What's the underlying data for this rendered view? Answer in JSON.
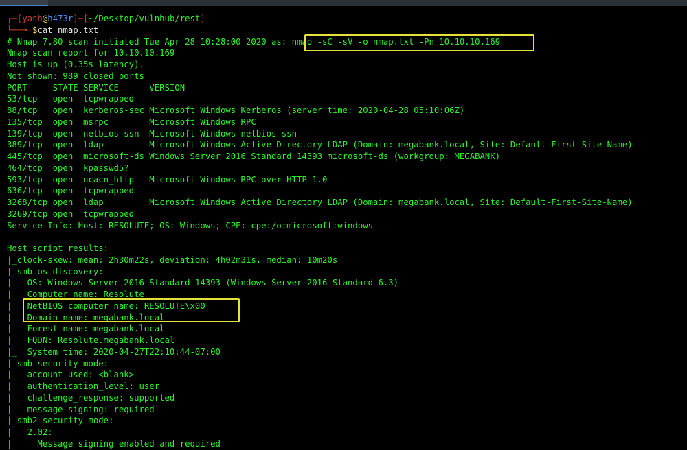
{
  "prompt": {
    "open_bracket": "┌─[",
    "user": "yash",
    "at": "@",
    "host": "h473r",
    "mid": "]─[",
    "path": "~/Desktop/vulnhub/rest",
    "close": "]",
    "arrow": "└──╼ ",
    "dollar": "$",
    "command": "cat nmap.txt"
  },
  "output": {
    "scan_header_prefix": "# Nmap 7.80 scan initiated Tue Apr 28 10:28:00 2020 as: ",
    "scan_command": "nmap -sC -sV -o nmap.txt -Pn 10.10.10.169",
    "lines_before_table": [
      "Nmap scan report for 10.10.10.169",
      "Host is up (0.35s latency).",
      "Not shown: 989 closed ports"
    ],
    "table_header": "PORT     STATE SERVICE      VERSION",
    "ports": [
      "53/tcp   open  tcpwrapped",
      "88/tcp   open  kerberos-sec Microsoft Windows Kerberos (server time: 2020-04-28 05:10:06Z)",
      "135/tcp  open  msrpc        Microsoft Windows RPC",
      "139/tcp  open  netbios-ssn  Microsoft Windows netbios-ssn",
      "389/tcp  open  ldap         Microsoft Windows Active Directory LDAP (Domain: megabank.local, Site: Default-First-Site-Name)",
      "445/tcp  open  microsoft-ds Windows Server 2016 Standard 14393 microsoft-ds (workgroup: MEGABANK)",
      "464/tcp  open  kpasswd5?",
      "593/tcp  open  ncacn_http   Microsoft Windows RPC over HTTP 1.0",
      "636/tcp  open  tcpwrapped",
      "3268/tcp open  ldap         Microsoft Windows Active Directory LDAP (Domain: megabank.local, Site: Default-First-Site-Name)",
      "3269/tcp open  tcpwrapped"
    ],
    "service_info": "Service Info: Host: RESOLUTE; OS: Windows; CPE: cpe:/o:microsoft:windows",
    "blank": "",
    "host_script_header": "Host script results:",
    "script_lines": [
      "|_clock-skew: mean: 2h30m22s, deviation: 4h02m31s, median: 10m20s",
      "| smb-os-discovery:",
      "|   OS: Windows Server 2016 Standard 14393 (Windows Server 2016 Standard 6.3)",
      "|   Computer name: Resolute",
      "|   NetBIOS computer name: RESOLUTE\\x00",
      "|   Domain name: megabank.local",
      "|   Forest name: megabank.local",
      "|   FQDN: Resolute.megabank.local",
      "|_  System time: 2020-04-27T22:10:44-07:00",
      "| smb-security-mode:",
      "|   account_used: <blank>",
      "|   authentication_level: user",
      "|   challenge_response: supported",
      "|_  message_signing: required",
      "| smb2-security-mode:",
      "|   2.02:",
      "|     Message signing enabled and required"
    ]
  },
  "colors": {
    "terminal_green": "#2bf12b",
    "prompt_red": "#d23a2a",
    "host_blue": "#4f8ef7",
    "highlight_yellow": "#e4e23a"
  }
}
